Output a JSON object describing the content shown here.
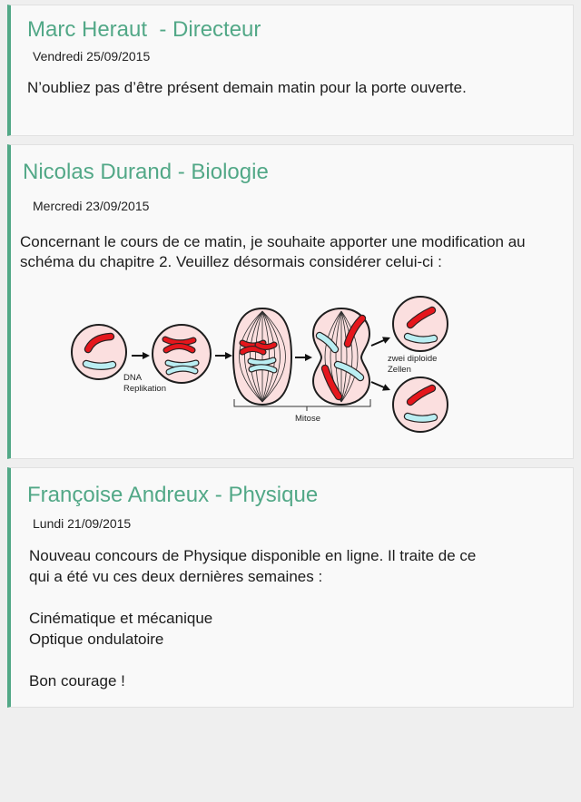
{
  "theme": {
    "accent": "#52a887",
    "background": "#efefef",
    "card": "#f9f9f9",
    "text": "#1b1b1b"
  },
  "posts": [
    {
      "author_title": "Marc Heraut  - Directeur",
      "date": "Vendredi 25/09/2015",
      "body": [
        "N’oubliez pas d’être présent demain matin pour la porte ouverte."
      ]
    },
    {
      "author_title": "Nicolas Durand - Biologie",
      "date": "Mercredi 23/09/2015",
      "body": [
        "Concernant le cours de ce matin, je souhaite apporter une modification au",
        "schéma du chapitre 2. Veuillez désormais considérer celui-ci :"
      ],
      "figure": {
        "labels": {
          "replication_line1": "DNA",
          "replication_line2": "Replikation",
          "mitosis": "Mitose",
          "result_line1": "zwei diploide",
          "result_line2": "Zellen"
        }
      }
    },
    {
      "author_title": "Françoise Andreux - Physique",
      "date": "Lundi 21/09/2015",
      "body": {
        "intro": [
          "Nouveau concours de Physique disponible en ligne. Il traite de ce",
          "qui a été vu ces deux dernières semaines :"
        ],
        "topics": [
          "Cinématique et mécanique",
          "Optique ondulatoire"
        ],
        "closing": "Bon courage !"
      }
    }
  ]
}
